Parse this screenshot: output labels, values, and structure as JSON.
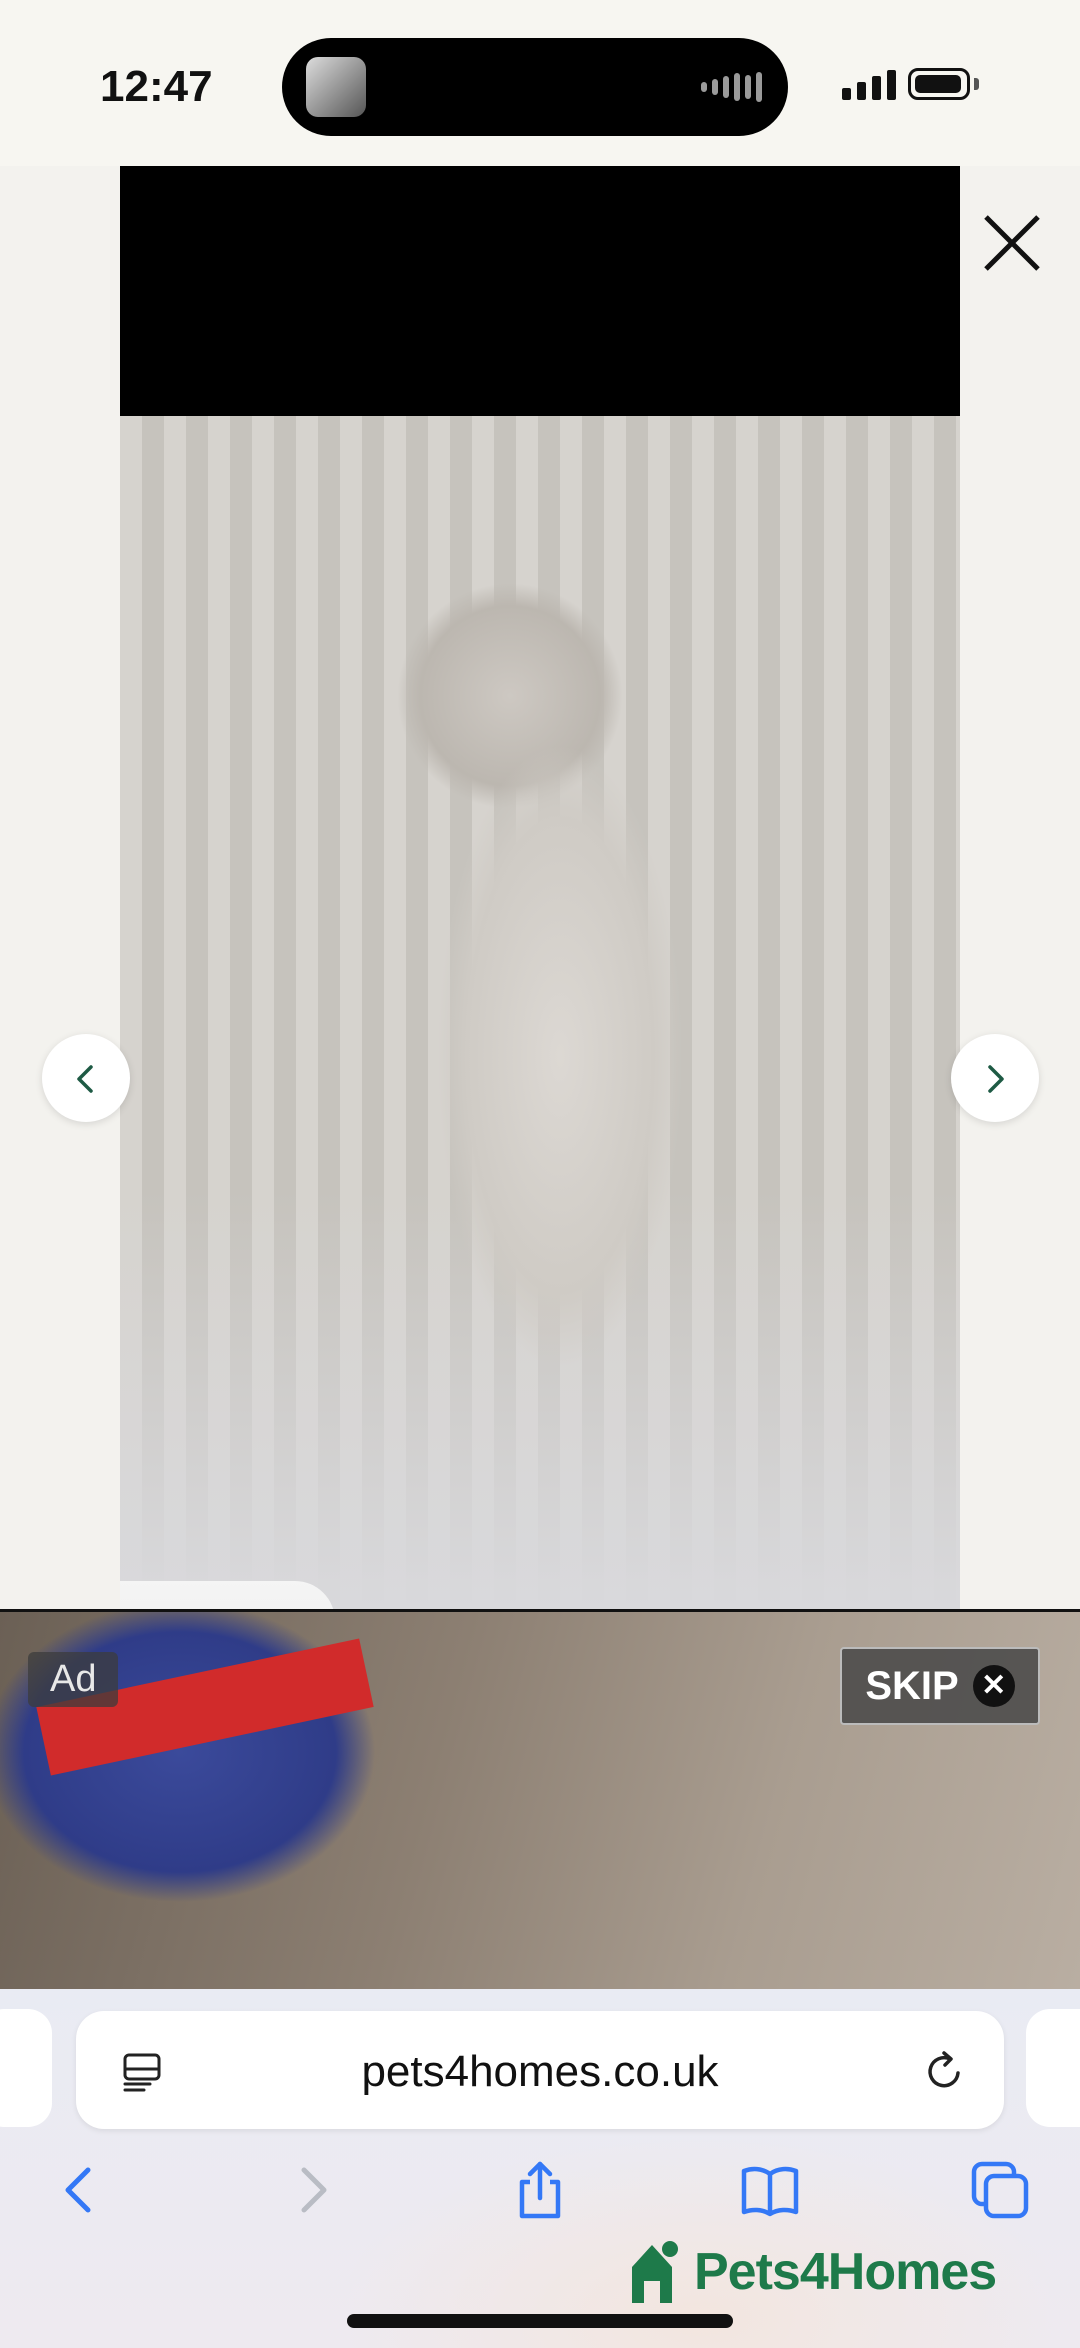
{
  "status_bar": {
    "time": "12:47"
  },
  "ad": {
    "badge": "Ad",
    "skip_label": "SKIP",
    "skip_close": "✕"
  },
  "browser": {
    "url": "pets4homes.co.uk"
  },
  "brand": {
    "name": "Pets4Homes",
    "color": "#1e7a4a"
  },
  "colors": {
    "accent": "#3478f6",
    "disabled": "#b9bcc4"
  },
  "icons": {
    "close": "close-icon",
    "prev": "chevron-left-icon",
    "next": "chevron-right-icon",
    "reader": "reader-mode-icon",
    "reload": "reload-icon",
    "back": "back-icon",
    "forward": "forward-icon",
    "share": "share-icon",
    "bookmarks": "bookmarks-icon",
    "tabs": "tabs-icon"
  }
}
